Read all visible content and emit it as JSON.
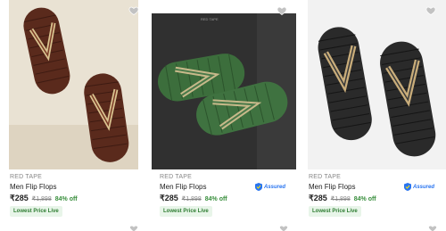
{
  "products": [
    {
      "brand": "RED TAPE",
      "name": "Men Flip Flops",
      "price": "₹285",
      "mrp": "₹1,898",
      "discount": "84% off",
      "badge": "Lowest Price Live",
      "assured": false
    },
    {
      "brand": "RED TAPE",
      "name": "Men Flip Flops",
      "price": "₹285",
      "mrp": "₹1,898",
      "discount": "84% off",
      "badge": "Lowest Price Live",
      "assured": true,
      "assured_label": "Assured"
    },
    {
      "brand": "RED TAPE",
      "name": "Men Flip Flops",
      "price": "₹285",
      "mrp": "₹1,898",
      "discount": "84% off",
      "badge": "Lowest Price Live",
      "assured": true,
      "assured_label": "Assured"
    }
  ],
  "colors": {
    "discount": "#388e3c",
    "assured": "#2874f0",
    "wishlist": "#c2c2c2"
  },
  "icons": {
    "wishlist": "heart-icon",
    "assured": "assured-shield-icon"
  }
}
